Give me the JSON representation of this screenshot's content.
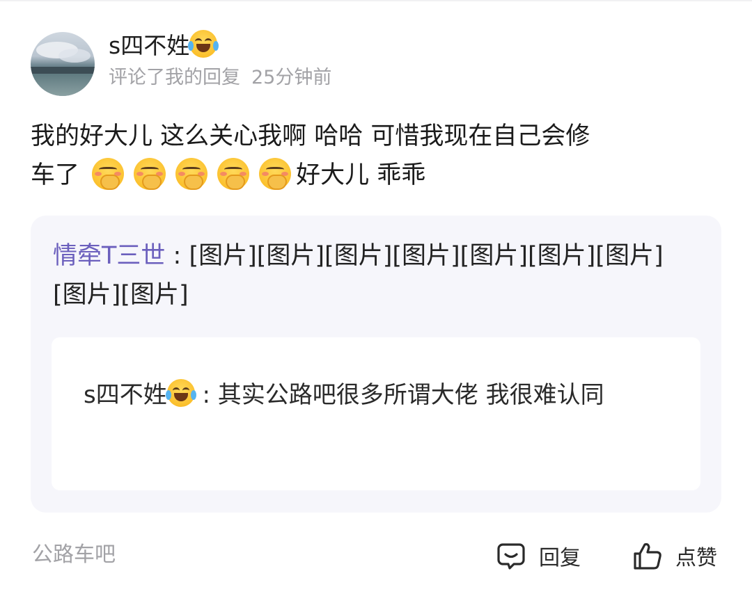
{
  "user": {
    "name": "s四不姓",
    "name_emoji": "face-with-tears-of-joy",
    "meta_action": "评论了我的回复",
    "meta_time": "25分钟前"
  },
  "comment": {
    "text_line1": "我的好大儿 这么关心我啊 哈哈 可惜我现在自己会修",
    "text_line2_prefix": "车了",
    "emoji": "face-with-hand-over-mouth",
    "emoji_count": 5,
    "text_line2_suffix": "好大儿 乖乖"
  },
  "quoted": {
    "author": "情牵T三世",
    "separator": " : ",
    "content": "[图片][图片][图片][图片][图片][图片][图片][图片][图片]"
  },
  "nested": {
    "author": "s四不姓",
    "author_emoji": "face-with-tears-of-joy",
    "separator": " : ",
    "content": "其实公路吧很多所谓大佬  我很难认同"
  },
  "footer": {
    "tag": "公路车吧",
    "reply_label": "回复",
    "like_label": "点赞"
  },
  "colors": {
    "quote_author": "#6b5fbd",
    "secondary_text": "#a2a2a6",
    "quote_background": "#f6f6fb"
  }
}
